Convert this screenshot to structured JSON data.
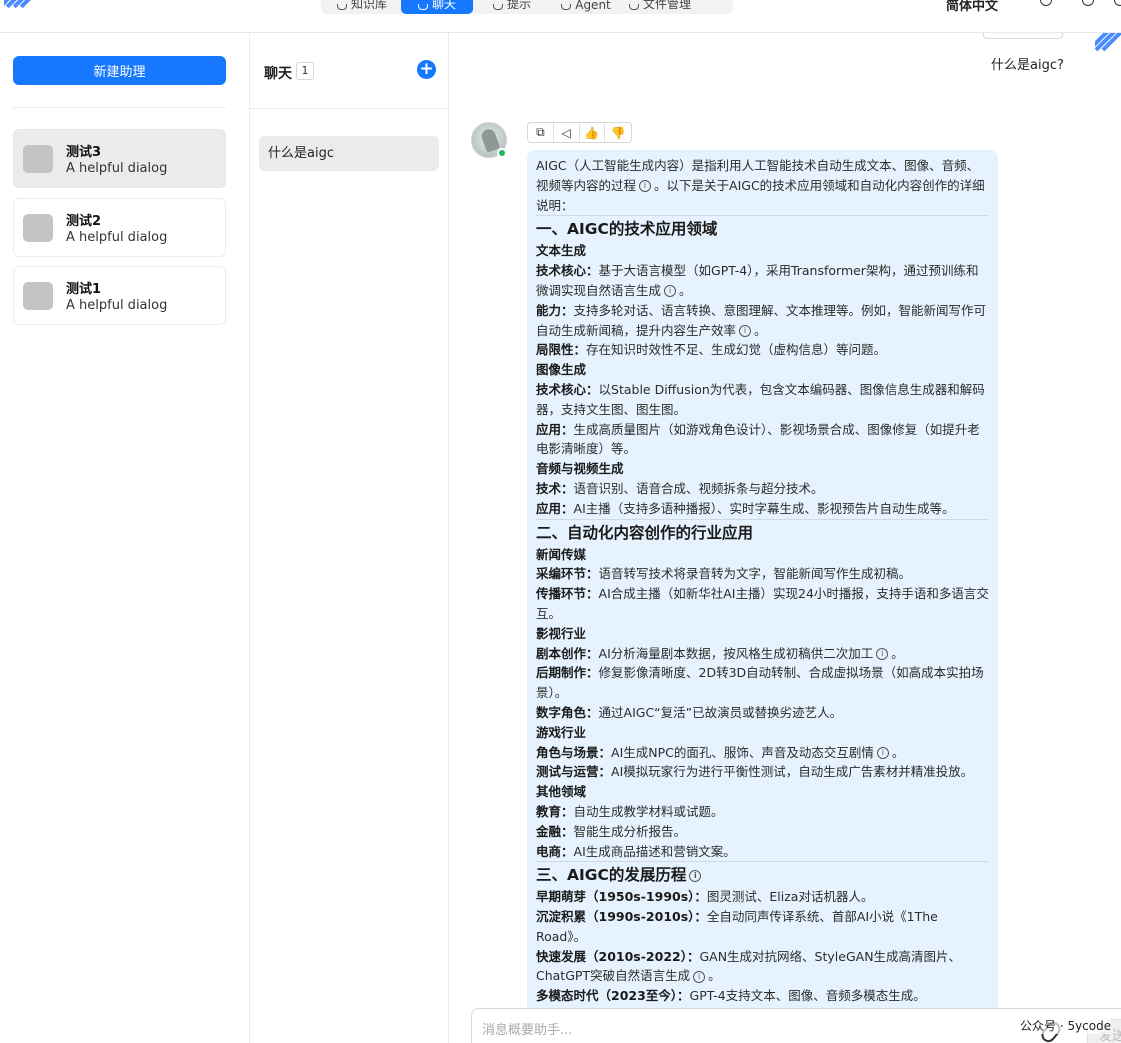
{
  "topbar": {
    "tabs": [
      "知识库",
      "聊天",
      "提示",
      "Agent",
      "文件管理"
    ],
    "language": "简体中文"
  },
  "sidebar": {
    "new_button": "新建助理",
    "assistants": [
      {
        "name": "测试3",
        "desc": "A helpful dialog"
      },
      {
        "name": "测试2",
        "desc": "A helpful dialog"
      },
      {
        "name": "测试1",
        "desc": "A helpful dialog"
      }
    ]
  },
  "conversations": {
    "title": "聊天",
    "count": "1",
    "add_icon": "+",
    "items": [
      "什么是aigc"
    ]
  },
  "chat": {
    "user_message": "什么是aigc?",
    "answer": {
      "intro": "AIGC（人工智能生成内容）是指利用人工智能技术自动生成文本、图像、音频、视频等内容的过程",
      "intro2": "。以下是关于AIGC的技术应用领域和自动化内容创作的详细说明：",
      "s1": "一、AIGC的技术应用领域",
      "s1_text": "文本生成",
      "s1_text_core_k": "技术核心：",
      "s1_text_core_v": "基于大语言模型（如GPT-4），采用Transformer架构，通过预训练和微调实现自然语言生成",
      "s1_text_cap_k": "能力：",
      "s1_text_cap_v": "支持多轮对话、语言转换、意图理解、文本推理等。例如，智能新闻写作可自动生成新闻稿，提升内容生产效率",
      "s1_text_lim_k": "局限性：",
      "s1_text_lim_v": "存在知识时效性不足、生成幻觉（虚构信息）等问题。",
      "s1_img": "图像生成",
      "s1_img_core_k": "技术核心：",
      "s1_img_core_v": "以Stable Diffusion为代表，包含文本编码器、图像信息生成器和解码器，支持文生图、图生图。",
      "s1_img_app_k": "应用：",
      "s1_img_app_v": "生成高质量图片（如游戏角色设计）、影视场景合成、图像修复（如提升老电影清晰度）等。",
      "s1_av": "音频与视频生成",
      "s1_av_tech_k": "技术：",
      "s1_av_tech_v": "语音识别、语音合成、视频拆条与超分技术。",
      "s1_av_app_k": "应用：",
      "s1_av_app_v": "AI主播（支持多语种播报）、实时字幕生成、影视预告片自动生成等。",
      "s2": "二、自动化内容创作的行业应用",
      "s2_news": "新闻传媒",
      "s2_news_1k": "采编环节：",
      "s2_news_1v": "语音转写技术将录音转为文字，智能新闻写作生成初稿。",
      "s2_news_2k": "传播环节：",
      "s2_news_2v": "AI合成主播（如新华社AI主播）实现24小时播报，支持手语和多语言交互。",
      "s2_film": "影视行业",
      "s2_film_1k": "剧本创作：",
      "s2_film_1v": "AI分析海量剧本数据，按风格生成初稿供二次加工",
      "s2_film_2k": "后期制作：",
      "s2_film_2v": "修复影像清晰度、2D转3D自动转制、合成虚拟场景（如高成本实拍场景）。",
      "s2_film_3k": "数字角色：",
      "s2_film_3v": "通过AIGC“复活”已故演员或替换劣迹艺人。",
      "s2_game": "游戏行业",
      "s2_game_1k": "角色与场景：",
      "s2_game_1v": "AI生成NPC的面孔、服饰、声音及动态交互剧情",
      "s2_game_2k": "测试与运营：",
      "s2_game_2v": "AI模拟玩家行为进行平衡性测试，自动生成广告素材并精准投放。",
      "s2_other": "其他领域",
      "s2_other_1k": "教育：",
      "s2_other_1v": "自动生成教学材料或试题。",
      "s2_other_2k": "金融：",
      "s2_other_2v": "智能生成分析报告。",
      "s2_other_3k": "电商：",
      "s2_other_3v": "AI生成商品描述和营销文案。",
      "s3": "三、AIGC的发展历程",
      "s3_1k": "早期萌芽（1950s-1990s）：",
      "s3_1v": "图灵测试、Eliza对话机器人。",
      "s3_2k": "沉淀积累（1990s-2010s）：",
      "s3_2v": "全自动同声传译系统、首部AI小说《1The Road》。",
      "s3_3k": "快速发展（2010s-2022）：",
      "s3_3v": "GAN生成对抗网络、StyleGAN生成高清图片、ChatGPT突破自然语言生成",
      "s3_4k": "多模态时代（2023至今）：",
      "s3_4v": "GPT-4支持文本、图像、音频多模态生成。",
      "period": "。"
    },
    "input_placeholder": "消息概要助手...",
    "send_label": "发送",
    "watermark": "公众号 · 5ycode"
  }
}
